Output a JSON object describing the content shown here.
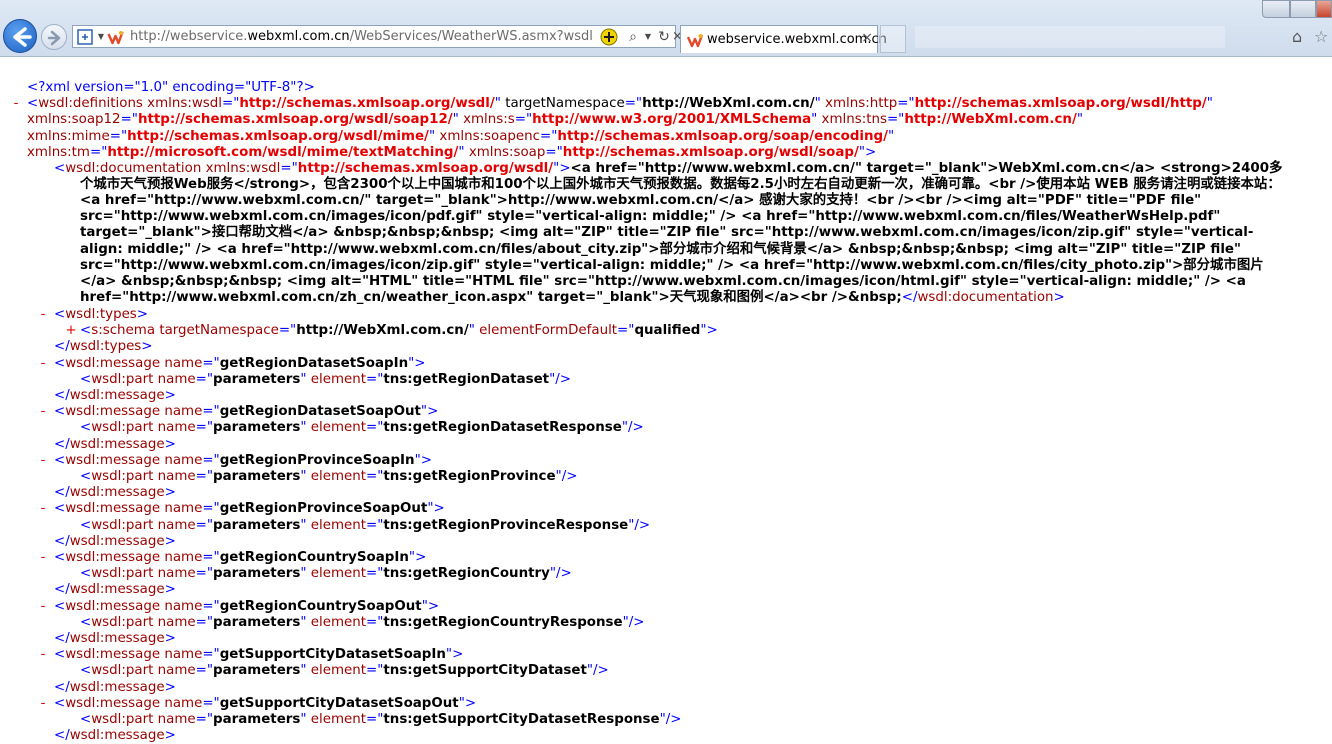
{
  "browser": {
    "url_prefix": "http://webservice.",
    "url_domain": "webxml.com.cn",
    "url_suffix": "/WebServices/WeatherWS.asmx?wsdl",
    "tab_title": "webservice.webxml.com.cn",
    "tab_close": "×",
    "icons": [
      "back-arrow-icon",
      "forward-arrow-icon",
      "compatibility-icon",
      "site-favicon-icon",
      "add-icon",
      "search-icon",
      "dropdown-icon",
      "refresh-icon",
      "close-icon",
      "home-icon",
      "favorites-star-icon"
    ]
  },
  "xml": {
    "decl": "<?xml version=\"1.0\" encoding=\"UTF-8\"?>",
    "defs": [
      "wsdl:definitions",
      "xmlns:wsdl",
      "http://schemas.xmlsoap.org/wsdl/",
      "targetNamespace",
      "http://WebXml.com.cn/",
      "xmlns:http",
      "http://schemas.xmlsoap.org/wsdl/http/",
      "xmlns:soap12",
      "http://schemas.xmlsoap.org/wsdl/soap12/",
      "xmlns:s",
      "http://www.w3.org/2001/XMLSchema",
      "xmlns:tns",
      "http://WebXml.com.cn/",
      "xmlns:mime",
      "http://schemas.xmlsoap.org/wsdl/mime/",
      "xmlns:soapenc",
      "http://schemas.xmlsoap.org/soap/encoding/",
      "xmlns:tm",
      "http://microsoft.com/wsdl/mime/textMatching/",
      "xmlns:soap",
      "http://schemas.xmlsoap.org/wsdl/soap/"
    ],
    "doc_open_tag": "wsdl:documentation",
    "doc_attr": "xmlns:wsdl",
    "doc_attr_value": "http://schemas.xmlsoap.org/wsdl/",
    "doc_text": [
      "<a href=\"http://www.webxml.com.cn/\" target=\"_blank\">WebXml.com.cn</a> <strong>2400多",
      "个城市天气预报Web服务</strong>，包含2300个以上中国城市和100个以上国外城市天气预报数据。数据每2.5小时左右自动更新一次，准确可靠。<br />使用本站 WEB 服务请注明或链接本站：",
      "<a href=\"http://www.webxml.com.cn/\" target=\"_blank\">http://www.webxml.com.cn/</a> 感谢大家的支持！<br /><br /><img alt=\"PDF\" title=\"PDF file\"",
      "src=\"http://www.webxml.com.cn/images/icon/pdf.gif\" style=\"vertical-align: middle;\" /> <a href=\"http://www.webxml.com.cn/files/WeatherWsHelp.pdf\"",
      "target=\"_blank\">接口帮助文档</a> &nbsp;&nbsp;&nbsp; <img alt=\"ZIP\" title=\"ZIP file\" src=\"http://www.webxml.com.cn/images/icon/zip.gif\" style=\"vertical-",
      "align: middle;\" /> <a href=\"http://www.webxml.com.cn/files/about_city.zip\">部分城市介绍和气候背景</a> &nbsp;&nbsp;&nbsp; <img alt=\"ZIP\" title=\"ZIP file\"",
      "src=\"http://www.webxml.com.cn/images/icon/zip.gif\" style=\"vertical-align: middle;\" /> <a href=\"http://www.webxml.com.cn/files/city_photo.zip\">部分城市图片",
      "</a> &nbsp;&nbsp;&nbsp; <img alt=\"HTML\" title=\"HTML file\" src=\"http://www.webxml.com.cn/images/icon/html.gif\" style=\"vertical-align: middle;\" /> <a",
      "href=\"http://www.webxml.com.cn/zh_cn/weather_icon.aspx\" target=\"_blank\">天气现象和图例</a><br />&nbsp;"
    ],
    "doc_close_tag": "</wsdl:documentation>",
    "types_open": "wsdl:types",
    "schema_tag": "s:schema",
    "schema_attr1": "targetNamespace",
    "schema_val1": "http://WebXml.com.cn/",
    "schema_attr2": "elementFormDefault",
    "schema_val2": "qualified",
    "types_close": "wsdl:types",
    "message_tag": "wsdl:message",
    "part_tag": "wsdl:part",
    "name_attr": "name",
    "element_attr": "element",
    "part_name": "parameters",
    "messages": [
      {
        "name": "getRegionDatasetSoapIn",
        "element": "tns:getRegionDataset"
      },
      {
        "name": "getRegionDatasetSoapOut",
        "element": "tns:getRegionDatasetResponse"
      },
      {
        "name": "getRegionProvinceSoapIn",
        "element": "tns:getRegionProvince"
      },
      {
        "name": "getRegionProvinceSoapOut",
        "element": "tns:getRegionProvinceResponse"
      },
      {
        "name": "getRegionCountrySoapIn",
        "element": "tns:getRegionCountry"
      },
      {
        "name": "getRegionCountrySoapOut",
        "element": "tns:getRegionCountryResponse"
      },
      {
        "name": "getSupportCityDatasetSoapIn",
        "element": "tns:getSupportCityDataset"
      },
      {
        "name": "getSupportCityDatasetSoapOut",
        "element": "tns:getSupportCityDatasetResponse"
      }
    ],
    "toggle_minus": "-",
    "toggle_plus": "+"
  }
}
